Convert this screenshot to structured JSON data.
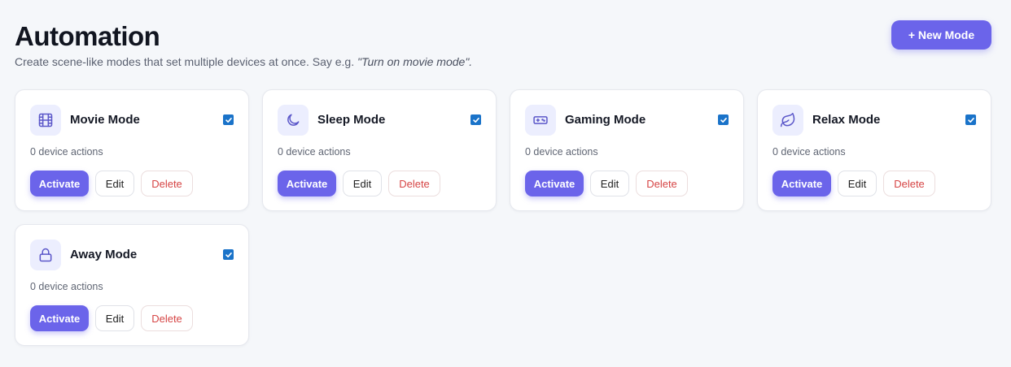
{
  "header": {
    "title": "Automation",
    "subtitle_text": "Create scene-like modes that set multiple devices at once. Say e.g.",
    "subtitle_example": "\"Turn on movie mode\".",
    "new_button_label": "+ New Mode"
  },
  "modes": [
    {
      "name": "Movie Mode",
      "icon": "film-icon",
      "enabled": true,
      "actions_text": "0 device actions",
      "activate_label": "Activate",
      "edit_label": "Edit",
      "delete_label": "Delete"
    },
    {
      "name": "Sleep Mode",
      "icon": "moon-icon",
      "enabled": true,
      "actions_text": "0 device actions",
      "activate_label": "Activate",
      "edit_label": "Edit",
      "delete_label": "Delete"
    },
    {
      "name": "Gaming Mode",
      "icon": "gamepad-icon",
      "enabled": true,
      "actions_text": "0 device actions",
      "activate_label": "Activate",
      "edit_label": "Edit",
      "delete_label": "Delete"
    },
    {
      "name": "Relax Mode",
      "icon": "leaf-icon",
      "enabled": true,
      "actions_text": "0 device actions",
      "activate_label": "Activate",
      "edit_label": "Edit",
      "delete_label": "Delete"
    },
    {
      "name": "Away Mode",
      "icon": "lock-icon",
      "enabled": true,
      "actions_text": "0 device actions",
      "activate_label": "Activate",
      "edit_label": "Edit",
      "delete_label": "Delete"
    }
  ],
  "colors": {
    "accent": "#6b64ea",
    "checkbox": "#1a73c9",
    "delete_text": "#d64545",
    "icon_bg": "#eceefe"
  }
}
